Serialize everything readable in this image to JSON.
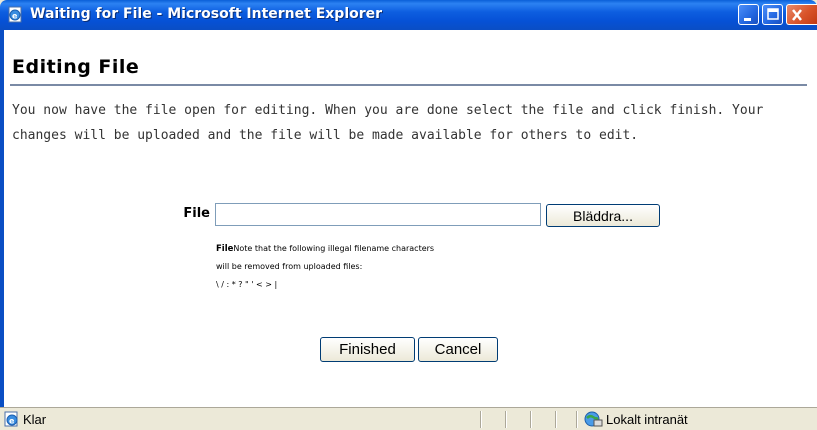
{
  "window": {
    "title": "Waiting for File - Microsoft Internet Explorer",
    "title_icon": "ie-page-icon",
    "controls": [
      "minimize-icon",
      "maximize-icon",
      "close-icon"
    ]
  },
  "page": {
    "heading": "Editing File",
    "description": "You now have the file open for editing. When you are done select the file and click finish. Your changes will be uploaded and the file will be made available for others to edit.",
    "file_label": "File",
    "file_input_value": "",
    "browse_label": "Bläddra...",
    "note_label": "File",
    "note_line1": "Note that the following illegal filename characters",
    "note_line2": "will be removed from uploaded files:",
    "note_line3": "\\ / : * ? \" ' < > |",
    "finish_label": "Finished",
    "cancel_label": "Cancel"
  },
  "statusbar": {
    "status_text": "Klar",
    "zone_text": "Lokalt intranät"
  },
  "colors": {
    "titlebar": "#0a5fd8",
    "rule": "#7a8aa5",
    "chrome": "#ece9d8"
  }
}
